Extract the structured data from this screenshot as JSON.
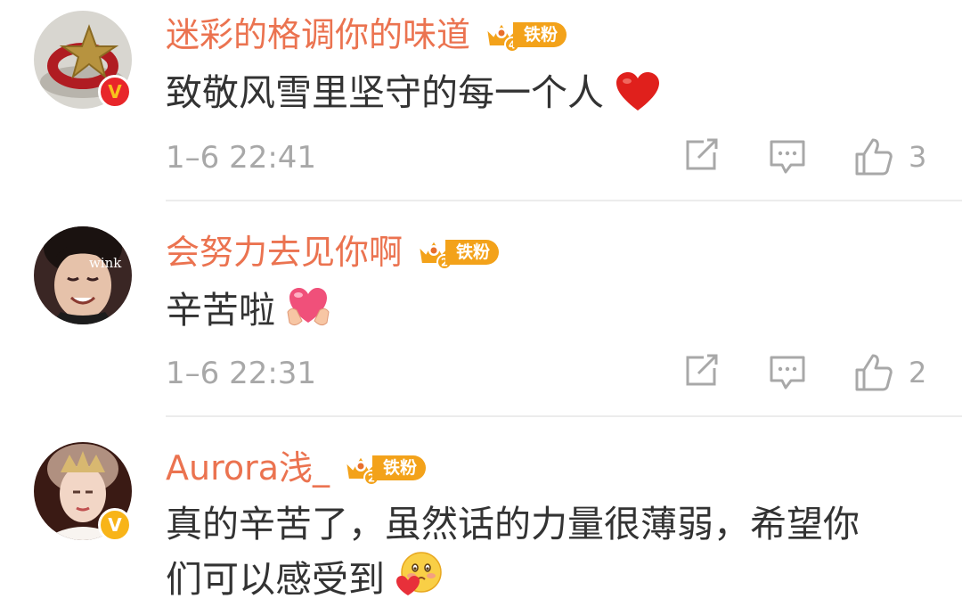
{
  "comments": [
    {
      "username": "迷彩的格调你的味道",
      "fan_level": "4",
      "fan_label": "铁粉",
      "text": "致敬风雪里坚守的每一个人",
      "emoji": "red-heart",
      "time": "1–6 22:41",
      "likes": "3",
      "verified_badge": "V",
      "verified_color": "#e8262a"
    },
    {
      "username": "会努力去见你啊",
      "fan_level": "2",
      "fan_label": "铁粉",
      "text": "辛苦啦",
      "emoji": "heart-hands",
      "avatar_caption": "wink",
      "time": "1–6 22:31",
      "likes": "2"
    },
    {
      "username": "Aurora浅_",
      "fan_level": "2",
      "fan_label": "铁粉",
      "text_line1": "真的辛苦了，虽然话的力量很薄弱，希望你",
      "text_line2": "们可以感受到",
      "emoji": "blushing-face-with-heart",
      "verified_badge": "V",
      "verified_color": "#f8b418"
    }
  ],
  "colors": {
    "username": "#eb7350",
    "text": "#333333",
    "meta": "#a8a8a8",
    "fan_badge": "#f3a21a"
  }
}
